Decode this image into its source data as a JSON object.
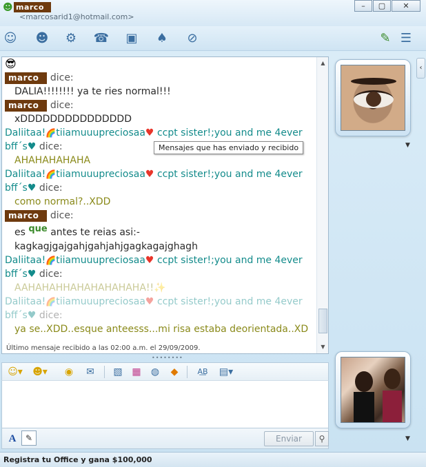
{
  "window": {
    "contact_name": "marco",
    "contact_email": "<marcosarid1@hotmail.com>",
    "minimize_label": "–",
    "maximize_label": "▢",
    "close_label": "✕"
  },
  "toolbar": {
    "icons": [
      "invite-icon",
      "activities-icon",
      "games-icon",
      "call-icon",
      "video-icon",
      "share-icon",
      "block-icon",
      "paint-icon",
      "menu-icon"
    ]
  },
  "conversation": {
    "messages": [
      {
        "sender": "marco",
        "dice": "dice:",
        "text": "DALIA!!!!!!!! ya te ries normal!!!"
      },
      {
        "sender": "marco",
        "dice": "dice:",
        "text": "xDDDDDDDDDDDDDDD"
      },
      {
        "sender_part1": "Daliitaa!",
        "sender_part2": "tiiamuuupreciosaa",
        "sender_part3": "ccpt sister!;you and me 4ever",
        "sender_part4": "bff´s",
        "dice": "dice:",
        "text": "AHAHAHAHAHA"
      },
      {
        "sender_part1": "Daliitaa!",
        "sender_part2": "tiiamuuupreciosaa",
        "sender_part3": "ccpt sister!;you and me 4ever",
        "sender_part4": "bff´s",
        "dice": "dice:",
        "text": "como normal?..XDD"
      },
      {
        "sender": "marco",
        "dice": "dice:",
        "text_a": "es",
        "text_que": "que",
        "text_b": "antes te reias asi:-",
        "text_c": "kagkagjgajgahjgahjahjgagkagajghagh"
      },
      {
        "sender_part1": "Daliitaa!",
        "sender_part2": "tiiamuuupreciosaa",
        "sender_part3": "ccpt sister!;you and me 4ever",
        "sender_part4": "bff´s",
        "dice": "dice:",
        "text": "AAHAHAHHAHAHAHAHAHA!!"
      },
      {
        "sender_part1": "Daliitaa!",
        "sender_part2": "tiiamuuupreciosaa",
        "sender_part3": "ccpt sister!;you and me 4ever",
        "sender_part4": "bff´s",
        "dice": "dice:",
        "text": "ya se..XDD..esque anteesss...mi risa estaba deorientada..XD"
      }
    ],
    "tooltip": "Mensajes que has enviado y recibido",
    "status": "Último mensaje recibido a las 02:00 a.m. el 29/09/2009."
  },
  "format_toolbar": {
    "icons": [
      "emoticon-icon",
      "wink-icon",
      "nudge-icon",
      "voice-clip-icon",
      "background-icon",
      "ink-icon",
      "sound-icon",
      "game-icon",
      "font-icon",
      "translate-icon"
    ]
  },
  "input": {
    "font_label": "A",
    "send_label": "Enviar"
  },
  "footer": {
    "ad_text": "Registra tu Office y gana $100,000"
  }
}
